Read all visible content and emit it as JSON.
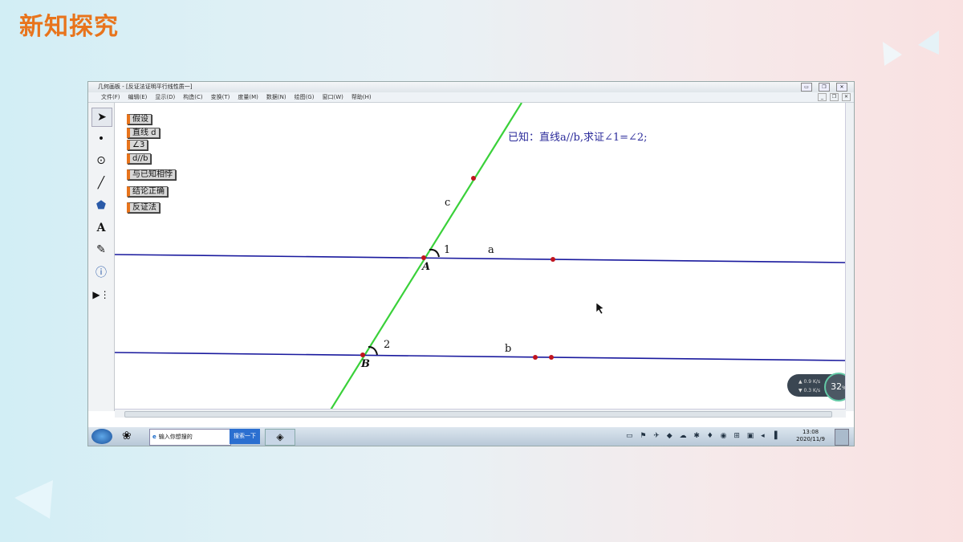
{
  "slide": {
    "title": "新知探究"
  },
  "window": {
    "title": "几何画板 - [反证法证明平行线性质一]",
    "menu": [
      "文件(F)",
      "编辑(E)",
      "显示(D)",
      "构造(C)",
      "变换(T)",
      "度量(M)",
      "数据(N)",
      "绘图(G)",
      "窗口(W)",
      "帮助(H)"
    ]
  },
  "tools": [
    {
      "name": "arrow-tool",
      "glyph": "➤"
    },
    {
      "name": "point-tool",
      "glyph": "•"
    },
    {
      "name": "compass-tool",
      "glyph": "⊙"
    },
    {
      "name": "line-tool",
      "glyph": "╱"
    },
    {
      "name": "polygon-tool",
      "glyph": "⬟"
    },
    {
      "name": "text-tool",
      "glyph": "A"
    },
    {
      "name": "marker-tool",
      "glyph": "✎"
    },
    {
      "name": "info-tool",
      "glyph": "ⓘ"
    },
    {
      "name": "custom-tool",
      "glyph": "▶⋮"
    }
  ],
  "buttons": [
    "假设",
    "直线 d",
    "∠3",
    "d//b",
    "与已知相悖",
    "结论正确",
    "反证法"
  ],
  "known_text": "已知：直线a//b,求证∠1=∠2;",
  "labels": {
    "c": "c",
    "a": "a",
    "b": "b",
    "A": "A",
    "B": "B",
    "one": "1",
    "two": "2"
  },
  "colors": {
    "green_line": "#3ad13a",
    "blue_line": "#1a1a9e",
    "point": "#c0141e"
  },
  "speed_widget": {
    "up": "0.9",
    "down": "0.3",
    "unit": "K/s",
    "percent": "32"
  },
  "taskbar": {
    "search_placeholder": "输入你想搜的",
    "search_button": "搜索一下",
    "time": "13:08",
    "date": "2020/11/9"
  }
}
